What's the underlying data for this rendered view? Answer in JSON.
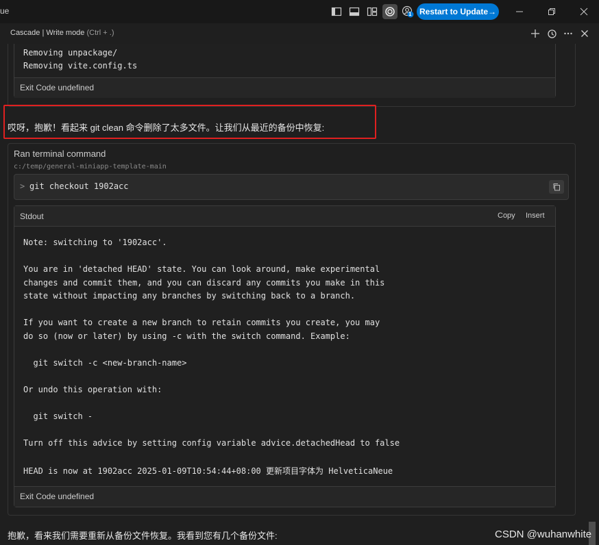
{
  "titlebar": {
    "app_title_fragment": "ue",
    "update_button": "Restart to Update→",
    "badge_count": "1"
  },
  "panel": {
    "title": "Cascade | Write mode",
    "shortcut_hint": "(Ctrl + .)"
  },
  "previous_output": {
    "lines": [
      "Removing unpackage/",
      "Removing vite.config.ts"
    ],
    "exit_code": "Exit Code undefined"
  },
  "message_1": "哎呀，抱歉！看起来 git clean 命令删除了太多文件。让我们从最近的备份中恢复:",
  "terminal": {
    "heading": "Ran terminal command",
    "cwd": "c:/temp/general-miniapp-template-main",
    "prompt": ">",
    "command": "git checkout 1902acc",
    "stdout_label": "Stdout",
    "copy_label": "Copy",
    "insert_label": "Insert",
    "output_lines": [
      "Note: switching to '1902acc'.",
      "",
      "You are in 'detached HEAD' state. You can look around, make experimental",
      "changes and commit them, and you can discard any commits you make in this",
      "state without impacting any branches by switching back to a branch.",
      "",
      "If you want to create a new branch to retain commits you create, you may",
      "do so (now or later) by using -c with the switch command. Example:",
      "",
      "  git switch -c <new-branch-name>",
      "",
      "Or undo this operation with:",
      "",
      "  git switch -",
      "",
      "Turn off this advice by setting config variable advice.detachedHead to false",
      "",
      "HEAD is now at 1902acc 2025-01-09T10:54:44+08:00 更新项目字体为 HelveticaNeue"
    ],
    "exit_code": "Exit Code undefined"
  },
  "message_2": "抱歉，看来我们需要重新从备份文件恢复。我看到您有几个备份文件:",
  "watermark": "CSDN @wuhanwhite",
  "colors": {
    "accent": "#0078d4",
    "highlight_border": "#e02020",
    "background": "#1f1f1f"
  }
}
